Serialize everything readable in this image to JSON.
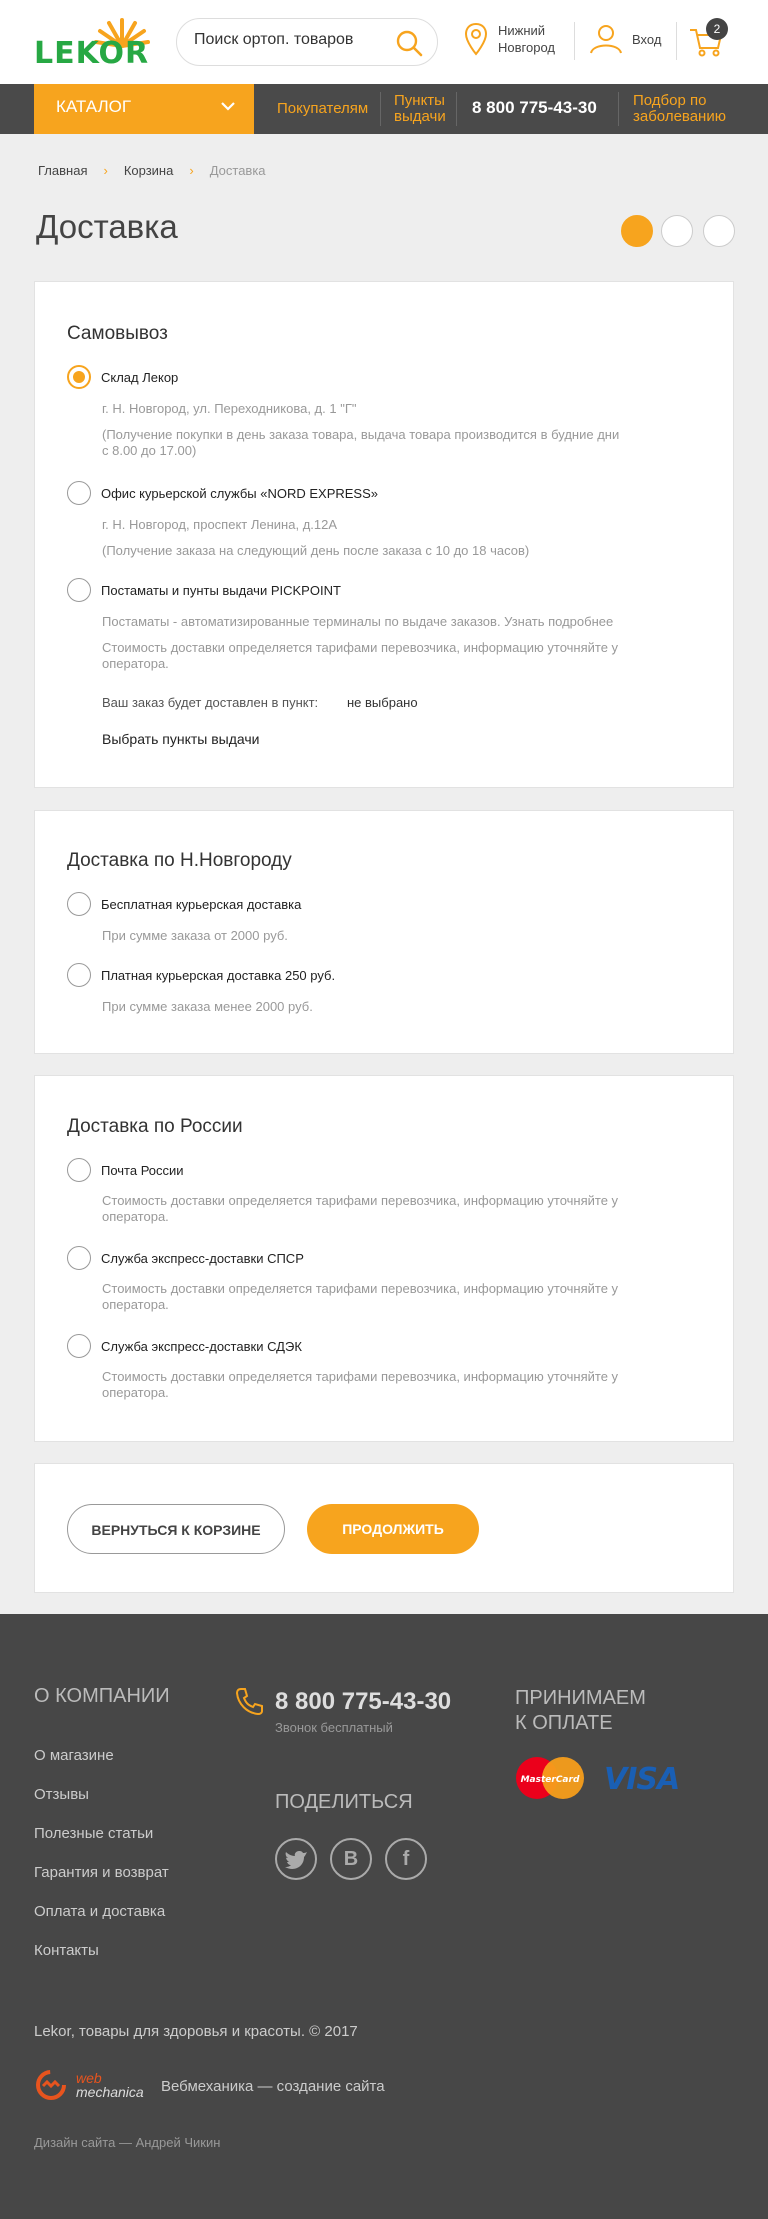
{
  "header": {
    "logo_text": "LEKOR",
    "search_placeholder": "Поиск ортоп. товаров",
    "city_line1": "Нижний",
    "city_line2": "Новгород",
    "login_label": "Вход",
    "cart_count": "2"
  },
  "nav": {
    "catalog_label": "КАТАЛОГ",
    "items": [
      {
        "line1": "Покупателям",
        "line2": ""
      },
      {
        "line1": "Пункты",
        "line2": "выдачи"
      },
      {
        "line1": "Подбор по",
        "line2": "заболеванию"
      }
    ],
    "phone": "8 800 775-43-30"
  },
  "breadcrumbs": [
    "Главная",
    "Корзина",
    "Доставка"
  ],
  "page_title": "Доставка",
  "pickup": {
    "title": "Самовывоз",
    "options": [
      {
        "label": "Склад Лекор",
        "address": "г. Н. Новгород, ул. Переходникова, д. 1 \"Г\"",
        "note": "(Получение покупки в день заказа товара, выдача товара производится в будние дни с 8.00 до 17.00)"
      },
      {
        "label": "Офис курьерской службы «NORD EXPRESS»",
        "address": "г. Н. Новгород, проспект Ленина, д.12А",
        "note": "(Получение заказа на следующий день после заказа с 10 до 18 часов)"
      },
      {
        "label": "Постаматы и пунты выдачи PICKPOINT",
        "address": "Постаматы - автоматизированные терминалы по выдаче заказов. Узнать подробнее",
        "note": "Стоимость доставки определяется тарифами перевозчика, информацию уточняйте у оператора."
      }
    ],
    "point_label": "Ваш заказ будет доставлен в пункт:",
    "point_value": "не выбрано",
    "choose_link": "Выбрать пункты выдачи"
  },
  "city_delivery": {
    "title": "Доставка по Н.Новгороду",
    "options": [
      {
        "label": "Бесплатная курьерская доставка",
        "note": "При сумме заказа от 2000 руб."
      },
      {
        "label": "Платная курьерская доставка 250 руб.",
        "note": "При сумме заказа менее 2000 руб."
      }
    ]
  },
  "russia_delivery": {
    "title": "Доставка по России",
    "options": [
      {
        "label": "Почта России",
        "note": "Стоимость доставки определяется тарифами перевозчика, информацию уточняйте у оператора."
      },
      {
        "label": "Служба экспресс-доставки СПСР",
        "note": "Стоимость доставки определяется тарифами перевозчика, информацию уточняйте у оператора."
      },
      {
        "label": "Служба экспресс-доставки СДЭК",
        "note": "Стоимость доставки определяется тарифами перевозчика, информацию уточняйте у оператора."
      }
    ]
  },
  "actions": {
    "back_label": "ВЕРНУТЬСЯ К КОРЗИНЕ",
    "continue_label": "ПРОДОЛЖИТЬ"
  },
  "footer": {
    "company_title": "О КОМПАНИИ",
    "links": [
      "О  магазине",
      "Отзывы",
      "Полезные статьи",
      "Гарантия и возврат",
      "Оплата и доставка",
      "Контакты"
    ],
    "phone": "8 800 775-43-30",
    "phone_note": "Звонок бесплатный",
    "share_title": "ПОДЕЛИТЬСЯ",
    "payment_title_1": "ПРИНИМАЕМ",
    "payment_title_2": "К ОПЛАТЕ",
    "mastercard_label": "MasterCard",
    "visa_label": "VISA",
    "copyright": "Lekor, товары для здоровья и красоты. © 2017",
    "dev_logo_1": "web",
    "dev_logo_2": "mechanica",
    "dev_text": "Вебмеханика — создание сайта",
    "design_credit": "Дизайн сайта — Андрей Чикин"
  },
  "colors": {
    "accent": "#f7a41e",
    "brand_green": "#27a844",
    "nav_bg": "#4a4a4a",
    "footer_bg": "#474747"
  }
}
